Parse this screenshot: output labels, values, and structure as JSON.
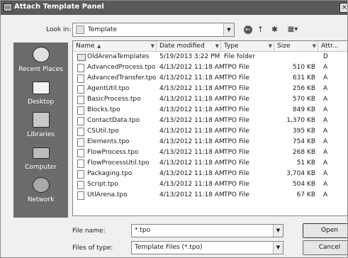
{
  "window": {
    "title": "Attach Template Panel",
    "close_glyph": "×"
  },
  "lookin": {
    "label": "Look in:",
    "value": "Template",
    "arrow": "▼"
  },
  "toolbar": {
    "back_glyph": "←",
    "up_glyph": "↑",
    "new_folder_glyph": "✱",
    "views_glyph": "▦▾"
  },
  "places": [
    {
      "label": "Recent Places",
      "icon": "recent-places-icon"
    },
    {
      "label": "Desktop",
      "icon": "desktop-icon"
    },
    {
      "label": "Libraries",
      "icon": "libraries-icon"
    },
    {
      "label": "Computer",
      "icon": "computer-icon"
    },
    {
      "label": "Network",
      "icon": "network-icon"
    }
  ],
  "columns": {
    "name": "Name",
    "date": "Date modified",
    "type": "Type",
    "size": "Size",
    "attr": "Attr...",
    "sort_glyph": "▲",
    "filter_glyph": "▼"
  },
  "files": [
    {
      "name": "OldArenaTemplates",
      "date": "5/19/2013 3:22 PM",
      "type": "File folder",
      "size": "",
      "attr": "D",
      "icon": "folder-icon"
    },
    {
      "name": "AdvancedProcess.tpo",
      "date": "4/13/2012 11:18 AM",
      "type": "TPO File",
      "size": "510 KB",
      "attr": "A",
      "icon": "file-icon"
    },
    {
      "name": "AdvancedTransfer.tpo",
      "date": "4/13/2012 11:18 AM",
      "type": "TPO File",
      "size": "631 KB",
      "attr": "A",
      "icon": "file-icon"
    },
    {
      "name": "AgentUtil.tpo",
      "date": "4/13/2012 11:18 AM",
      "type": "TPO File",
      "size": "256 KB",
      "attr": "A",
      "icon": "file-icon"
    },
    {
      "name": "BasicProcess.tpo",
      "date": "4/13/2012 11:18 AM",
      "type": "TPO File",
      "size": "570 KB",
      "attr": "A",
      "icon": "file-icon"
    },
    {
      "name": "Blocks.tpo",
      "date": "4/13/2012 11:18 AM",
      "type": "TPO File",
      "size": "849 KB",
      "attr": "A",
      "icon": "file-icon"
    },
    {
      "name": "ContactData.tpo",
      "date": "4/13/2012 11:18 AM",
      "type": "TPO File",
      "size": "1,370 KB",
      "attr": "A",
      "icon": "file-icon"
    },
    {
      "name": "CSUtil.tpo",
      "date": "4/13/2012 11:18 AM",
      "type": "TPO File",
      "size": "395 KB",
      "attr": "A",
      "icon": "file-icon"
    },
    {
      "name": "Elements.tpo",
      "date": "4/13/2012 11:18 AM",
      "type": "TPO File",
      "size": "754 KB",
      "attr": "A",
      "icon": "file-icon"
    },
    {
      "name": "FlowProcess.tpo",
      "date": "4/13/2012 11:18 AM",
      "type": "TPO File",
      "size": "268 KB",
      "attr": "A",
      "icon": "file-icon"
    },
    {
      "name": "FlowProcessUtil.tpo",
      "date": "4/13/2012 11:18 AM",
      "type": "TPO File",
      "size": "51 KB",
      "attr": "A",
      "icon": "file-icon"
    },
    {
      "name": "Packaging.tpo",
      "date": "4/13/2012 11:18 AM",
      "type": "TPO File",
      "size": "3,704 KB",
      "attr": "A",
      "icon": "file-icon"
    },
    {
      "name": "Script.tpo",
      "date": "4/13/2012 11:18 AM",
      "type": "TPO File",
      "size": "504 KB",
      "attr": "A",
      "icon": "file-icon"
    },
    {
      "name": "UtlArena.tpo",
      "date": "4/13/2012 11:18 AM",
      "type": "TPO File",
      "size": "67 KB",
      "attr": "A",
      "icon": "file-icon"
    }
  ],
  "filename": {
    "label": "File name:",
    "value": "*.tpo",
    "arrow": "▼"
  },
  "filetype": {
    "label": "Files of type:",
    "value": "Template Files (*.tpo)",
    "arrow": "▼"
  },
  "buttons": {
    "open": "Open",
    "cancel": "Cancel"
  }
}
